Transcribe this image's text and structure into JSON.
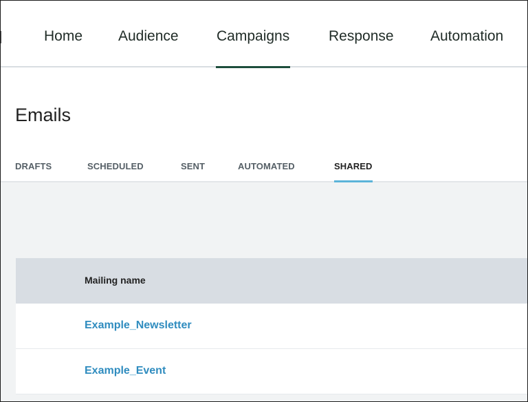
{
  "top_nav": {
    "items": [
      {
        "label": "Home",
        "active": false
      },
      {
        "label": "Audience",
        "active": false
      },
      {
        "label": "Campaigns",
        "active": true
      },
      {
        "label": "Response",
        "active": false
      },
      {
        "label": "Automation",
        "active": false
      }
    ]
  },
  "page": {
    "title": "Emails"
  },
  "sub_tabs": {
    "items": [
      {
        "label": "DRAFTS",
        "active": false
      },
      {
        "label": "SCHEDULED",
        "active": false
      },
      {
        "label": "SENT",
        "active": false
      },
      {
        "label": "AUTOMATED",
        "active": false
      },
      {
        "label": "SHARED",
        "active": true
      }
    ]
  },
  "table": {
    "columns": [
      "Mailing name"
    ],
    "rows": [
      {
        "mailing_name": "Example_Newsletter"
      },
      {
        "mailing_name": "Example_Event"
      }
    ]
  },
  "colors": {
    "nav_active_underline": "#1d4d3c",
    "tab_active_underline": "#5bb3d9",
    "link": "#2f8cbf",
    "header_bg": "#d8dde3",
    "content_bg": "#f1f3f4"
  }
}
